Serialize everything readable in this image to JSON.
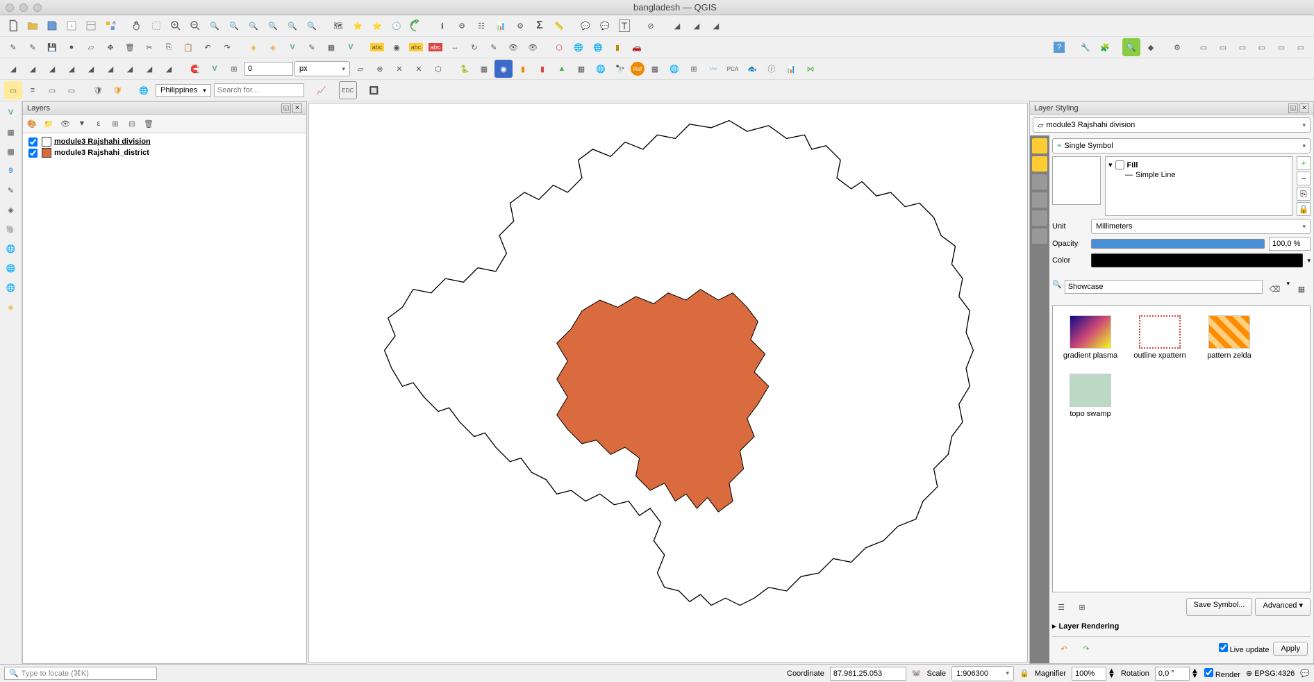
{
  "window": {
    "title": "bangladesh — QGIS"
  },
  "nominatim": {
    "country": "Philippines",
    "search_placeholder": "Search for..."
  },
  "spinbox": {
    "value": "0",
    "unit": "px"
  },
  "layers_panel": {
    "title": "Layers",
    "items": [
      {
        "checked": true,
        "swatch": "#ffffff",
        "name": "module3 Rajshahi division",
        "bold": true
      },
      {
        "checked": true,
        "swatch": "#d96b3f",
        "name": "module3 Rajshahi_district",
        "bold": false
      }
    ]
  },
  "styling": {
    "title": "Layer Styling",
    "layer": "module3 Rajshahi division",
    "renderer": "Single Symbol",
    "tree": {
      "fill": "Fill",
      "line": "Simple Line"
    },
    "unit_label": "Unit",
    "unit": "Millimeters",
    "opacity_label": "Opacity",
    "opacity": "100,0 %",
    "color_label": "Color",
    "showcase_label": "Showcase",
    "swatches": [
      {
        "name": "gradient  plasma",
        "bg": "linear-gradient(135deg,#0d0887,#cc4778,#f0f921)"
      },
      {
        "name": "outline xpattern",
        "bg": "#fff"
      },
      {
        "name": "pattern zelda",
        "bg": "repeating-linear-gradient(45deg,#ff8c00 0 8px,#ffd080 8px 16px)"
      },
      {
        "name": "topo swamp",
        "bg": "#bdd8c4"
      }
    ],
    "save_symbol": "Save Symbol...",
    "advanced": "Advanced",
    "layer_rendering": "Layer Rendering",
    "live_update": "Live update",
    "apply": "Apply"
  },
  "statusbar": {
    "locate_placeholder": "Type to locate (⌘K)",
    "coord_label": "Coordinate",
    "coord": "87.981,25.053",
    "scale_label": "Scale",
    "scale": "1:906300",
    "magnifier_label": "Magnifier",
    "magnifier": "100%",
    "rotation_label": "Rotation",
    "rotation": "0,0 °",
    "render": "Render",
    "crs": "EPSG:4326"
  }
}
